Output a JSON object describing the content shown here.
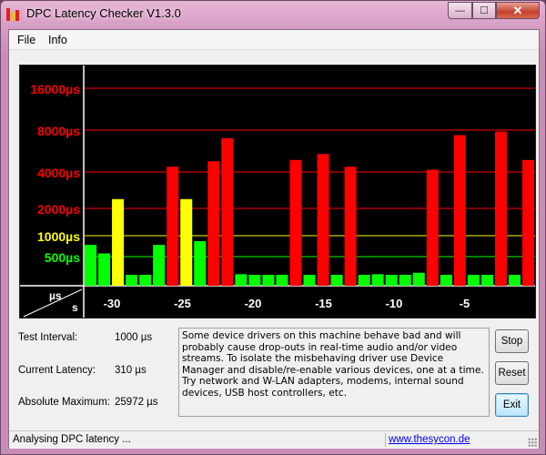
{
  "window": {
    "title": "DPC Latency Checker V1.3.0",
    "min_glyph": "—",
    "max_glyph": "☐",
    "close_glyph": "✕"
  },
  "menu": {
    "file": "File",
    "info": "Info"
  },
  "chart_data": {
    "type": "bar",
    "ylabels": [
      "16000µs",
      "8000µs",
      "4000µs",
      "2000µs",
      "1000µs",
      "500µs"
    ],
    "ylabel_colors": [
      "#ff0000",
      "#ff0000",
      "#ff0000",
      "#ff0000",
      "#ffff00",
      "#00ff00"
    ],
    "threshold_colors": {
      "green": "#00ff00",
      "yellow": "#ffff00",
      "red": "#ff0000"
    },
    "axis_corner": {
      "top": "µs",
      "bottom": "s"
    },
    "xlabels": [
      "-30",
      "-25",
      "-20",
      "-15",
      "-10",
      "-5"
    ],
    "xlabel_positions": [
      -30,
      -25,
      -20,
      -15,
      -10,
      -5
    ],
    "xlim": [
      -32,
      0
    ],
    "ylim_log": [
      250,
      28000
    ],
    "values": [
      600,
      500,
      1600,
      250,
      250,
      600,
      3200,
      1600,
      650,
      3600,
      5900,
      320,
      250,
      290,
      280,
      3700,
      250,
      4200,
      280,
      3200,
      310,
      320,
      260,
      280,
      330,
      3000,
      280,
      6300,
      280,
      270,
      6800,
      260,
      3700
    ]
  },
  "stats": {
    "test_interval_label": "Test Interval:",
    "test_interval_value": "1000 µs",
    "current_latency_label": "Current Latency:",
    "current_latency_value": "310 µs",
    "absolute_maximum_label": "Absolute Maximum:",
    "absolute_maximum_value": "25972 µs"
  },
  "message": "Some device drivers on this machine behave bad and will probably cause drop-outs in real-time audio and/or video streams. To isolate the misbehaving driver use Device Manager and disable/re-enable various devices, one at a time. Try network and W-LAN adapters, modems, internal sound devices, USB host controllers, etc.",
  "buttons": {
    "stop": "Stop",
    "reset": "Reset",
    "exit": "Exit"
  },
  "status": {
    "text": "Analysing DPC latency ...",
    "link": "www.thesycon.de"
  }
}
